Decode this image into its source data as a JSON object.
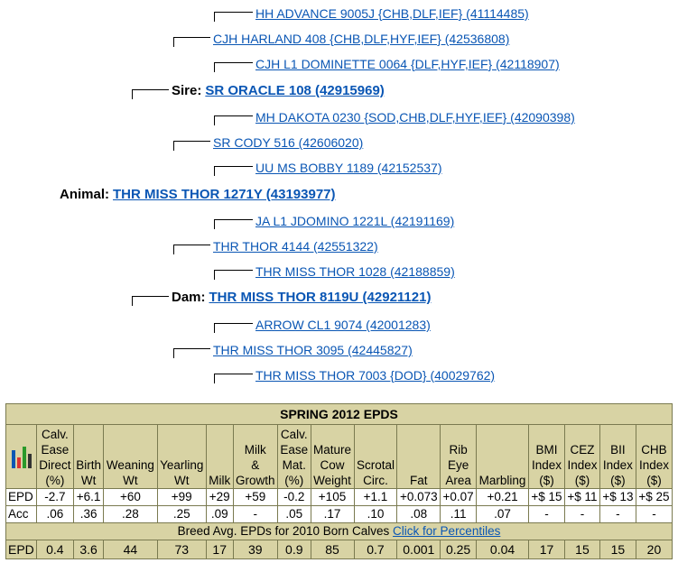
{
  "pedigree": {
    "n1": "HH ADVANCE 9005J {CHB,DLF,IEF} (41114485)",
    "n2": "CJH HARLAND 408 {CHB,DLF,HYF,IEF} (42536808)",
    "n3": "CJH L1 DOMINETTE 0064 {DLF,HYF,IEF} (42118907)",
    "sire_label": "Sire:",
    "sire": "SR ORACLE 108 (42915969)",
    "n4": "MH DAKOTA 0230 {SOD,CHB,DLF,HYF,IEF} (42090398)",
    "n5": "SR CODY 516 (42606020)",
    "n6": "UU MS BOBBY 1189 (42152537)",
    "animal_label": "Animal:",
    "animal": "THR MISS THOR 1271Y (43193977)",
    "n7": "JA L1 JDOMINO 1221L (42191169)",
    "n8": "THR THOR 4144 (42551322)",
    "n9": "THR MISS THOR 1028 (42188859)",
    "dam_label": "Dam:",
    "dam": "THR MISS THOR 8119U (42921121)",
    "n10": "ARROW CL1 9074 (42001283)",
    "n11": "THR MISS THOR 3095 (42445827)",
    "n12": "THR MISS THOR 7003 {DOD} (40029762)"
  },
  "epd": {
    "title": "SPRING 2012 EPDS",
    "headers": [
      [
        "Calv.",
        "Ease",
        "Direct",
        "(%)"
      ],
      [
        "Birth",
        "Wt"
      ],
      [
        "Weaning",
        "Wt"
      ],
      [
        "Yearling",
        "Wt"
      ],
      [
        "Milk"
      ],
      [
        "Milk",
        "&",
        "Growth"
      ],
      [
        "Calv.",
        "Ease",
        "Mat.",
        "(%)"
      ],
      [
        "Mature",
        "Cow",
        "Weight"
      ],
      [
        "Scrotal",
        "Circ."
      ],
      [
        "Fat"
      ],
      [
        "Rib",
        "Eye",
        "Area"
      ],
      [
        "Marbling"
      ],
      [
        "BMI",
        "Index",
        "($)"
      ],
      [
        "CEZ",
        "Index",
        "($)"
      ],
      [
        "BII",
        "Index",
        "($)"
      ],
      [
        "CHB",
        "Index",
        "($)"
      ]
    ],
    "epd_label": "EPD",
    "epd_values": [
      "-2.7",
      "+6.1",
      "+60",
      "+99",
      "+29",
      "+59",
      "-0.2",
      "+105",
      "+1.1",
      "+0.073",
      "+0.07",
      "+0.21",
      "+$ 15",
      "+$ 11",
      "+$ 13",
      "+$ 25"
    ],
    "acc_label": "Acc",
    "acc_values": [
      ".06",
      ".36",
      ".28",
      ".25",
      ".09",
      "-",
      ".05",
      ".17",
      ".10",
      ".08",
      ".11",
      ".07",
      "-",
      "-",
      "-",
      "-"
    ],
    "breed_text": "Breed Avg. EPDs for 2010 Born Calves",
    "breed_link": "Click for Percentiles",
    "avg_label": "EPD",
    "avg_values": [
      "0.4",
      "3.6",
      "44",
      "73",
      "17",
      "39",
      "0.9",
      "85",
      "0.7",
      "0.001",
      "0.25",
      "0.04",
      "17",
      "15",
      "15",
      "20"
    ],
    "icon": "bar-chart-icon",
    "colors": {
      "link": "#0a56b4",
      "table_bg": "#d8d3a4"
    }
  }
}
